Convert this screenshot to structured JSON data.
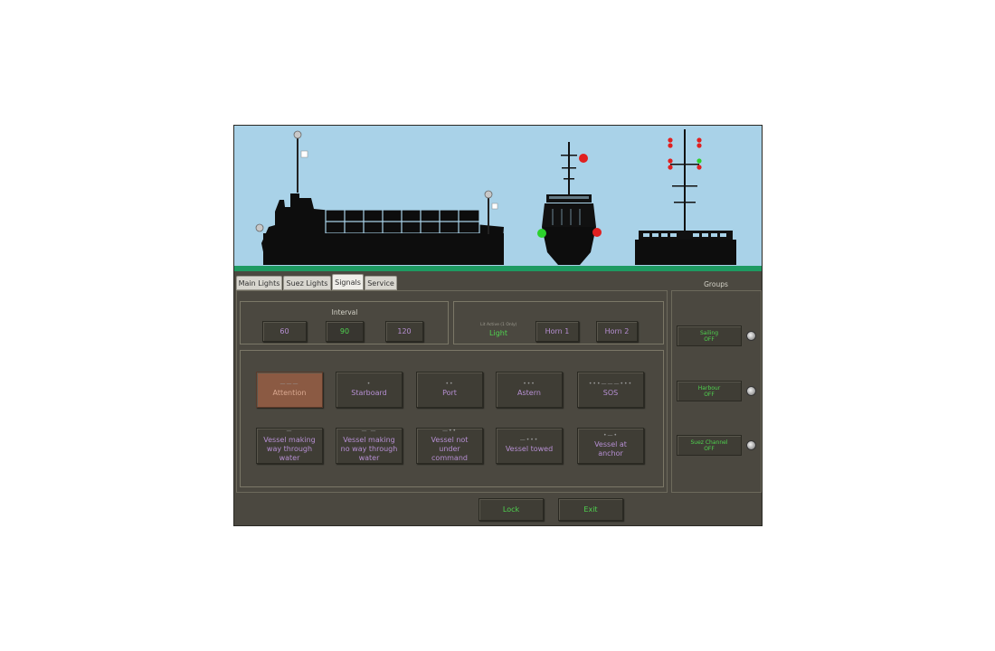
{
  "tabs": [
    "Main Lights",
    "Suez Lights",
    "Signals",
    "Service"
  ],
  "active_tab": "Signals",
  "groups_title": "Groups",
  "interval": {
    "label": "Interval",
    "options": [
      "60",
      "90",
      "120"
    ],
    "selected": "90"
  },
  "output": {
    "caption": "Lit Active (1 Only)",
    "light": "Light",
    "horn1": "Horn 1",
    "horn2": "Horn 2"
  },
  "signals": [
    {
      "label": "Attention",
      "pattern": "———"
    },
    {
      "label": "Starboard",
      "pattern": "•"
    },
    {
      "label": "Port",
      "pattern": "••"
    },
    {
      "label": "Astern",
      "pattern": "•••"
    },
    {
      "label": "SOS",
      "pattern": "•••———•••"
    },
    {
      "label": "Vessel making way through water",
      "pattern": "—"
    },
    {
      "label": "Vessel making no way through water",
      "pattern": "— —"
    },
    {
      "label": "Vessel not under command",
      "pattern": "—••"
    },
    {
      "label": "Vessel towed",
      "pattern": "—•••"
    },
    {
      "label": "Vessel at anchor",
      "pattern": "•—•"
    }
  ],
  "groups": [
    {
      "name": "Sailing",
      "state": "OFF"
    },
    {
      "name": "Harbour",
      "state": "OFF"
    },
    {
      "name": "Suez Channel",
      "state": "OFF"
    }
  ],
  "footer": {
    "lock": "Lock",
    "exit": "Exit"
  },
  "colors": {
    "sky": "#a9d2e8",
    "sea_strip": "#1e9a62",
    "panel": "#4b4840",
    "button_text": "#b68fd3",
    "active_text": "#4fd24f",
    "attention_bg": "#8b5a43"
  }
}
